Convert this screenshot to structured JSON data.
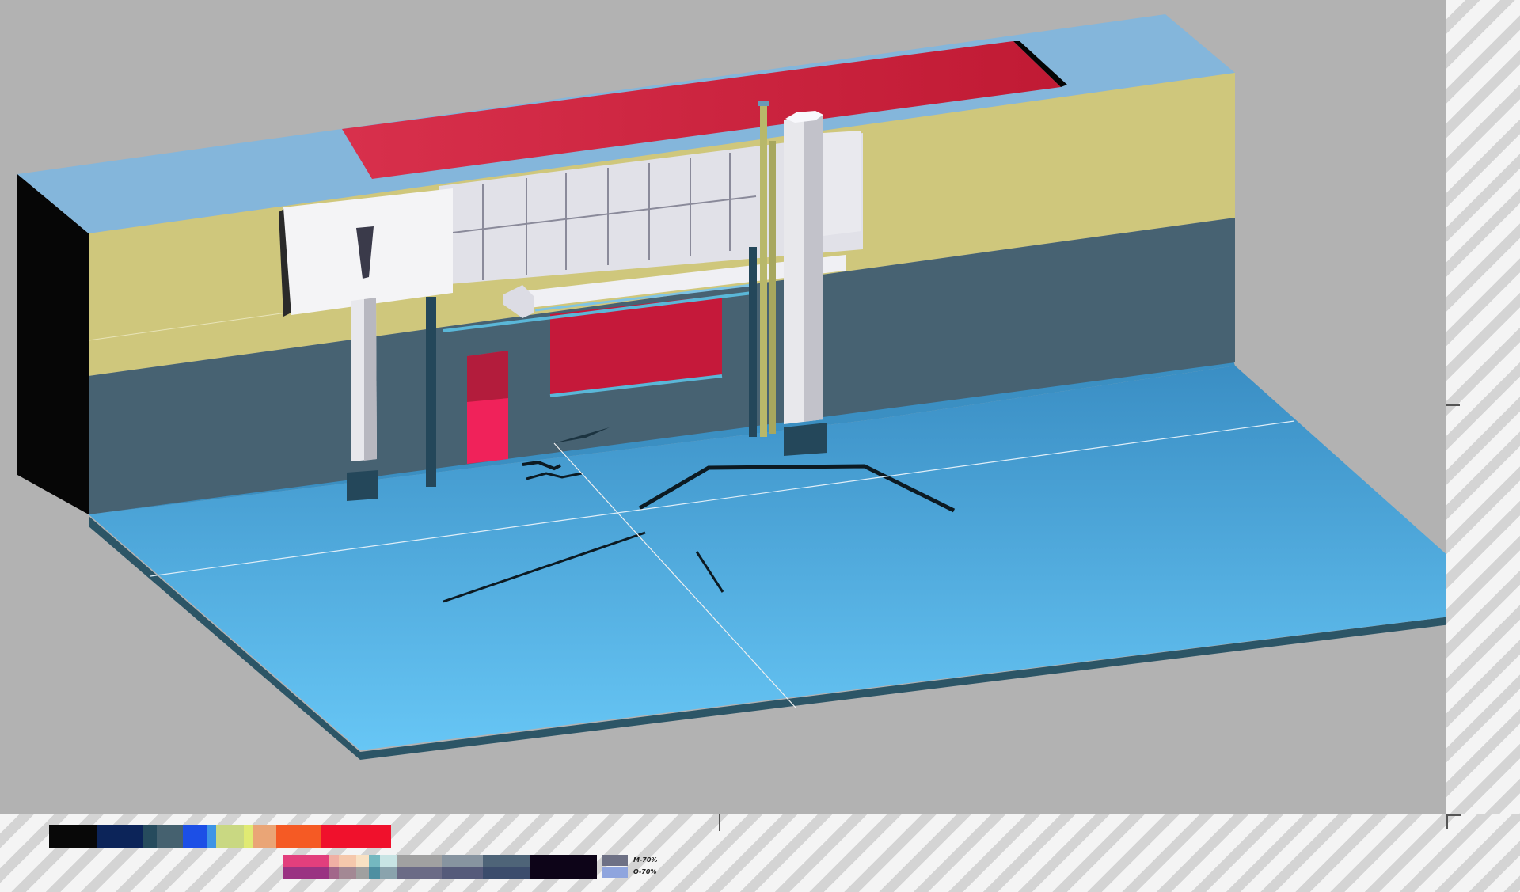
{
  "palette_primary": [
    {
      "name": "black",
      "color": "#080808"
    },
    {
      "name": "navy",
      "color": "#0c2459"
    },
    {
      "name": "slate-teal",
      "color": "#264b5d"
    },
    {
      "name": "gray-slate",
      "color": "#45616f"
    },
    {
      "name": "royal-blue",
      "color": "#1c4fe6"
    },
    {
      "name": "sky-blue",
      "color": "#3e94e6"
    },
    {
      "name": "pale-lime",
      "color": "#c9d882"
    },
    {
      "name": "yellow-lime",
      "color": "#e0ea73"
    },
    {
      "name": "peach",
      "color": "#eaa576"
    },
    {
      "name": "orange-red",
      "color": "#f55a24"
    },
    {
      "name": "crimson",
      "color": "#f0112c"
    }
  ],
  "palette_secondary": [
    {
      "top": "#e23f7d",
      "bottom": "#9a3282"
    },
    {
      "top": "#f0b0a4",
      "bottom": "#a2678a"
    },
    {
      "top": "#f5c8ac",
      "bottom": "#a38894"
    },
    {
      "top": "#f8e1c3",
      "bottom": "#a0a0a0"
    },
    {
      "top": "#74b8c0",
      "bottom": "#4e8fa1"
    },
    {
      "top": "#c8e4e4",
      "bottom": "#8aa3ad"
    },
    {
      "top": "#a1a1a1",
      "bottom": "#6b6b86"
    },
    {
      "top": "#8794a0",
      "bottom": "#555a7a"
    },
    {
      "top": "#4e6478",
      "bottom": "#3b4c6c"
    },
    {
      "top": "#0d0418",
      "bottom": "#0d0418"
    }
  ],
  "legend": [
    {
      "label": "M-70%",
      "color": "#6e7185"
    },
    {
      "label": "O-70%",
      "color": "#8fa5de"
    }
  ],
  "colors": {
    "canvas_bg": "#b2b2b2",
    "floor": "#4aa8df",
    "roof": "#84b6db",
    "band_yellow": "#cfc77c",
    "band_slate": "#476272",
    "accent_red": "#d42040"
  }
}
